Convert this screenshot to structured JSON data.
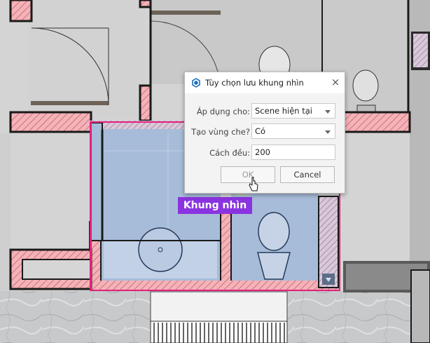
{
  "dialog": {
    "title": "Tùy chọn lưu khung nhìn",
    "close_label": "×",
    "apply_label": "Áp dụng cho:",
    "apply_value": "Scene hiện tại",
    "mask_label": "Tạo vùng che?",
    "mask_value": "Có",
    "offset_label": "Cách đều:",
    "offset_value": "200",
    "ok_label": "OK",
    "cancel_label": "Cancel",
    "logo_icon": "sketchup-logo-icon",
    "dropdown_icon": "chevron-down-icon"
  },
  "viewport": {
    "tag_label": "Khung nhìn"
  },
  "colors": {
    "wall_hatch": "#f2a8ae",
    "frame_magenta": "#e0217f",
    "floor_blue": "#a8bedc",
    "tag_purple": "#8a33e0",
    "highlight_yellow": "#ffe94a"
  }
}
